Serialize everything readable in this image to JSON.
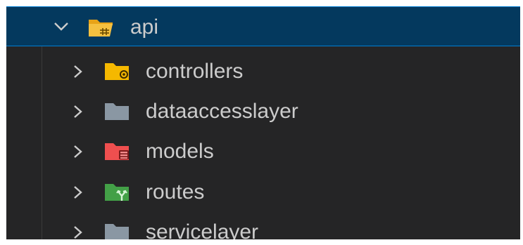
{
  "explorer": {
    "root": {
      "label": "api",
      "expanded": true,
      "icon": "folder-api-open-icon",
      "color": "#f0b429"
    },
    "children": [
      {
        "label": "controllers",
        "icon": "folder-controllers-icon",
        "color": "#f5b800"
      },
      {
        "label": "dataaccesslayer",
        "icon": "folder-icon",
        "color": "#8a97a3"
      },
      {
        "label": "models",
        "icon": "folder-models-icon",
        "color": "#ef4f4f"
      },
      {
        "label": "routes",
        "icon": "folder-routes-icon",
        "color": "#43a047"
      },
      {
        "label": "servicelayer",
        "icon": "folder-icon",
        "color": "#8a97a3"
      }
    ]
  }
}
